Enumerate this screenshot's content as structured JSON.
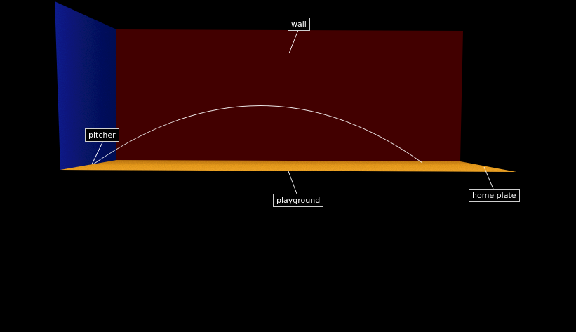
{
  "labels": {
    "wall": "wall",
    "pitcher": "pitcher",
    "playground": "playground",
    "home_plate": "home plate"
  },
  "colors": {
    "background": "#000000",
    "wall": "#420000",
    "side_wall": "#0a1a8c",
    "playground": "#f5a623",
    "trajectory": "#ffffff",
    "label_border": "#cfcfcf"
  }
}
